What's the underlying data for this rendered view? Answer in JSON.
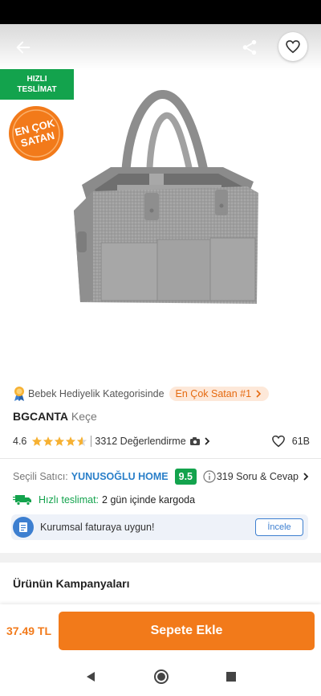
{
  "product_image": {
    "fast_delivery_badge": [
      "HIZLI",
      "TESLİMAT"
    ],
    "best_seller_badge": [
      "EN ÇOK",
      "SATAN"
    ]
  },
  "product": {
    "category_rank_text": "Bebek Hediyelik Kategorisinde",
    "rank_pill": "En Çok Satan #1",
    "brand": "BGCANTA",
    "name": "Keçe",
    "rating": "4.6",
    "stars_filled": 4.6,
    "reviews": "3312 Değerlendirme",
    "likes": "61B"
  },
  "seller": {
    "label": "Seçili Satıcı:",
    "name": "YUNUSOĞLU HOME",
    "score": "9.5",
    "qa": "319 Soru & Cevap"
  },
  "delivery": {
    "fast_label": "Hızlı teslimat:",
    "text": "2 gün içinde kargoda"
  },
  "invoice": {
    "text": "Kurumsal faturaya uygun!",
    "button": "İncele"
  },
  "campaigns": {
    "title": "Ürünün Kampanyaları"
  },
  "bottom": {
    "price": "37.49 TL",
    "add_to_cart": "Sepete Ekle"
  },
  "colors": {
    "accent": "#f27a1a",
    "green": "#13a34d",
    "blue": "#2a7fc9"
  }
}
